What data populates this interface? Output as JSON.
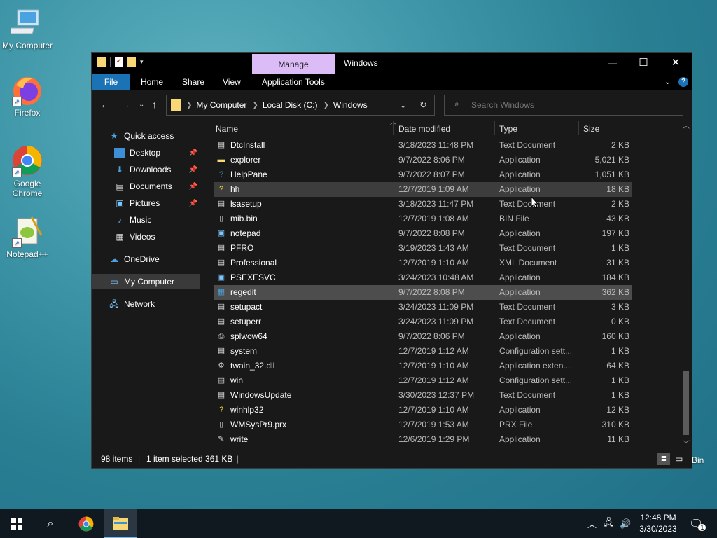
{
  "desktop": {
    "icons": [
      {
        "label": "My Computer"
      },
      {
        "label": "Firefox"
      },
      {
        "label": "Google Chrome"
      },
      {
        "label": "Notepad++"
      }
    ],
    "recycle_label": "Bin"
  },
  "window": {
    "context_tab": "Manage",
    "title": "Windows",
    "controls": {
      "minimize": "—",
      "maximize": "☐",
      "close": "✕"
    },
    "ribbon_tabs": [
      "File",
      "Home",
      "Share",
      "View",
      "Application Tools"
    ],
    "address": {
      "parts": [
        "My Computer",
        "Local Disk (C:)",
        "Windows"
      ]
    },
    "search": {
      "placeholder": "Search Windows"
    },
    "nav": [
      {
        "label": "Quick access"
      },
      {
        "label": "Desktop"
      },
      {
        "label": "Downloads"
      },
      {
        "label": "Documents"
      },
      {
        "label": "Pictures"
      },
      {
        "label": "Music"
      },
      {
        "label": "Videos"
      },
      {
        "label": "OneDrive"
      },
      {
        "label": "My Computer"
      },
      {
        "label": "Network"
      }
    ],
    "columns": {
      "name": "Name",
      "date": "Date modified",
      "type": "Type",
      "size": "Size"
    },
    "files": [
      {
        "name": "DtcInstall",
        "date": "3/18/2023 11:48 PM",
        "type": "Text Document",
        "size": "2 KB"
      },
      {
        "name": "explorer",
        "date": "9/7/2022 8:06 PM",
        "type": "Application",
        "size": "5,021 KB"
      },
      {
        "name": "HelpPane",
        "date": "9/7/2022 8:07 PM",
        "type": "Application",
        "size": "1,051 KB"
      },
      {
        "name": "hh",
        "date": "12/7/2019 1:09 AM",
        "type": "Application",
        "size": "18 KB"
      },
      {
        "name": "lsasetup",
        "date": "3/18/2023 11:47 PM",
        "type": "Text Document",
        "size": "2 KB"
      },
      {
        "name": "mib.bin",
        "date": "12/7/2019 1:08 AM",
        "type": "BIN File",
        "size": "43 KB"
      },
      {
        "name": "notepad",
        "date": "9/7/2022 8:08 PM",
        "type": "Application",
        "size": "197 KB"
      },
      {
        "name": "PFRO",
        "date": "3/19/2023 1:43 AM",
        "type": "Text Document",
        "size": "1 KB"
      },
      {
        "name": "Professional",
        "date": "12/7/2019 1:10 AM",
        "type": "XML Document",
        "size": "31 KB"
      },
      {
        "name": "PSEXESVC",
        "date": "3/24/2023 10:48 AM",
        "type": "Application",
        "size": "184 KB"
      },
      {
        "name": "regedit",
        "date": "9/7/2022 8:08 PM",
        "type": "Application",
        "size": "362 KB"
      },
      {
        "name": "setupact",
        "date": "3/24/2023 11:09 PM",
        "type": "Text Document",
        "size": "3 KB"
      },
      {
        "name": "setuperr",
        "date": "3/24/2023 11:09 PM",
        "type": "Text Document",
        "size": "0 KB"
      },
      {
        "name": "splwow64",
        "date": "9/7/2022 8:06 PM",
        "type": "Application",
        "size": "160 KB"
      },
      {
        "name": "system",
        "date": "12/7/2019 1:12 AM",
        "type": "Configuration sett...",
        "size": "1 KB"
      },
      {
        "name": "twain_32.dll",
        "date": "12/7/2019 1:10 AM",
        "type": "Application exten...",
        "size": "64 KB"
      },
      {
        "name": "win",
        "date": "12/7/2019 1:12 AM",
        "type": "Configuration sett...",
        "size": "1 KB"
      },
      {
        "name": "WindowsUpdate",
        "date": "3/30/2023 12:37 PM",
        "type": "Text Document",
        "size": "1 KB"
      },
      {
        "name": "winhlp32",
        "date": "12/7/2019 1:10 AM",
        "type": "Application",
        "size": "12 KB"
      },
      {
        "name": "WMSysPr9.prx",
        "date": "12/7/2019 1:53 AM",
        "type": "PRX File",
        "size": "310 KB"
      },
      {
        "name": "write",
        "date": "12/6/2019 1:29 PM",
        "type": "Application",
        "size": "11 KB"
      }
    ],
    "status": {
      "count": "98 items",
      "selection": "1 item selected  361 KB"
    }
  },
  "taskbar": {
    "time": "12:48 PM",
    "date": "3/30/2023",
    "notification_count": "1"
  },
  "colors": {
    "file_tab": "#1b73b6",
    "manage_tab": "#dcbcf7",
    "selected_row": "#4d4d4d",
    "hover_row": "#3d3d3d"
  }
}
